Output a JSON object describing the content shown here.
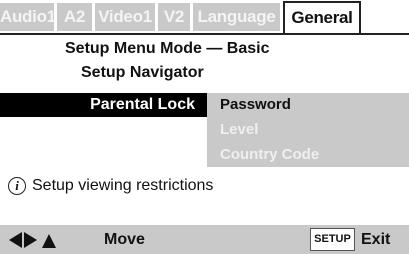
{
  "tabs": [
    {
      "label": "Audio1",
      "active": false
    },
    {
      "label": "A2",
      "active": false
    },
    {
      "label": "Video1",
      "active": false
    },
    {
      "label": "V2",
      "active": false
    },
    {
      "label": "Language",
      "active": false
    },
    {
      "label": "General",
      "active": true
    }
  ],
  "header": {
    "mode_line": "Setup Menu Mode — Basic",
    "navigator": "Setup Navigator"
  },
  "menu": {
    "selected": "Parental Lock",
    "submenu": [
      {
        "label": "Password",
        "enabled": true
      },
      {
        "label": "Level",
        "enabled": false
      },
      {
        "label": "Country Code",
        "enabled": false
      }
    ]
  },
  "info": {
    "icon": "info-icon",
    "text": "Setup viewing restrictions"
  },
  "footer": {
    "nav_icons": [
      "arrow-left-icon",
      "arrow-right-icon",
      "arrow-up-icon"
    ],
    "move_label": "Move",
    "setup_label": "SETUP",
    "exit_label": "Exit"
  },
  "colors": {
    "tab_inactive_bg": "#c9c9c9",
    "tab_inactive_text": "#f4f4f4",
    "selection_bg": "#000000",
    "submenu_bg": "#c9c9c9",
    "disabled_text": "#efefef"
  }
}
